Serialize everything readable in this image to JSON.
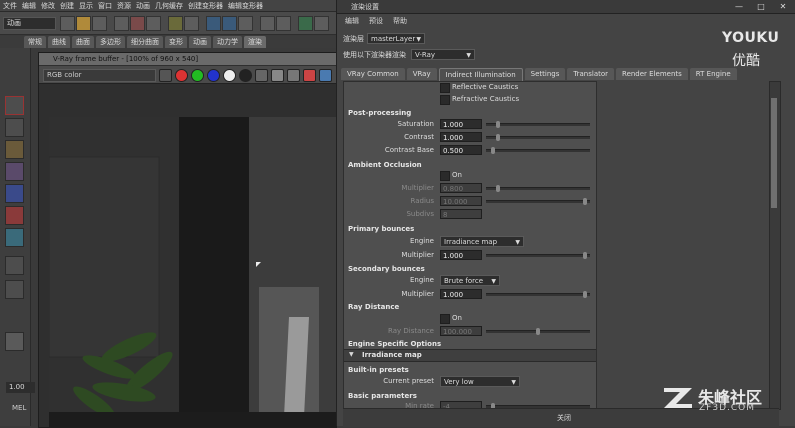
{
  "maya": {
    "menu": [
      "文件",
      "编辑",
      "修改",
      "创建",
      "显示",
      "窗口",
      "资源",
      "动画",
      "几何缓存",
      "创建变形器",
      "编辑变形器"
    ],
    "mode": "动画",
    "shelf_tabs": [
      "常规",
      "曲线",
      "曲面",
      "多边形",
      "细分曲面",
      "变形",
      "动画",
      "动力学",
      "渲染"
    ],
    "value_field": "1.00",
    "mel_label": "MEL"
  },
  "vfb": {
    "title": "V-Ray frame buffer - [100% of 960 x 540]",
    "channel": "RGB color"
  },
  "render_settings": {
    "window_title": "渲染设置",
    "menu": [
      "编辑",
      "预设",
      "帮助"
    ],
    "render_layer_label": "渲染层",
    "render_layer_value": "masterLayer",
    "renderer_label": "使用以下渲染器渲染",
    "renderer_value": "V-Ray",
    "tabs": [
      "VRay Common",
      "VRay",
      "Indirect Illumination",
      "Settings",
      "Translator",
      "Render Elements",
      "RT Engine"
    ],
    "active_tab": "Indirect Illumination",
    "caustics": {
      "reflective": "Reflective Caustics",
      "refractive": "Refractive Caustics"
    },
    "post_processing": {
      "title": "Post-processing",
      "saturation_label": "Saturation",
      "saturation": "1.000",
      "saturation_level": 0.1,
      "contrast_label": "Contrast",
      "contrast": "1.000",
      "contrast_level": 0.1,
      "contrast_base_label": "Contrast Base",
      "contrast_base": "0.500",
      "contrast_base_level": 0.05
    },
    "ambient_occlusion": {
      "title": "Ambient Occlusion",
      "on_label": "On",
      "multiplier_label": "Multiplier",
      "multiplier": "0.800",
      "multiplier_level": 0.1,
      "radius_label": "Radius",
      "radius": "10.000",
      "radius_level": 0.97,
      "subdivs_label": "Subdivs",
      "subdivs": "8"
    },
    "primary_bounces": {
      "title": "Primary bounces",
      "engine_label": "Engine",
      "engine": "Irradiance map",
      "multiplier_label": "Multiplier",
      "multiplier": "1.000",
      "multiplier_level": 0.97
    },
    "secondary_bounces": {
      "title": "Secondary bounces",
      "engine_label": "Engine",
      "engine": "Brute force",
      "multiplier_label": "Multiplier",
      "multiplier": "1.000",
      "multiplier_level": 0.97
    },
    "ray_distance": {
      "title": "Ray Distance",
      "on_label": "On",
      "ray_distance_label": "Ray Distance",
      "ray_distance": "100.000",
      "ray_distance_level": 0.5
    },
    "engine_specific": {
      "title": "Engine Specific Options",
      "rollout": "Irradiance map"
    },
    "builtin_presets": {
      "title": "Built-in presets",
      "current_preset_label": "Current preset",
      "current_preset": "Very low"
    },
    "basic_parameters": {
      "title": "Basic parameters",
      "min_rate_label": "Min rate",
      "min_rate": "-4",
      "min_rate_level": 0.05
    },
    "close_label": "关闭"
  },
  "watermarks": {
    "youku": "YOUKU",
    "youku_cn": "优酷",
    "zf3d_cn": "朱峰社区",
    "zf3d_url": "ZF3D.COM"
  }
}
